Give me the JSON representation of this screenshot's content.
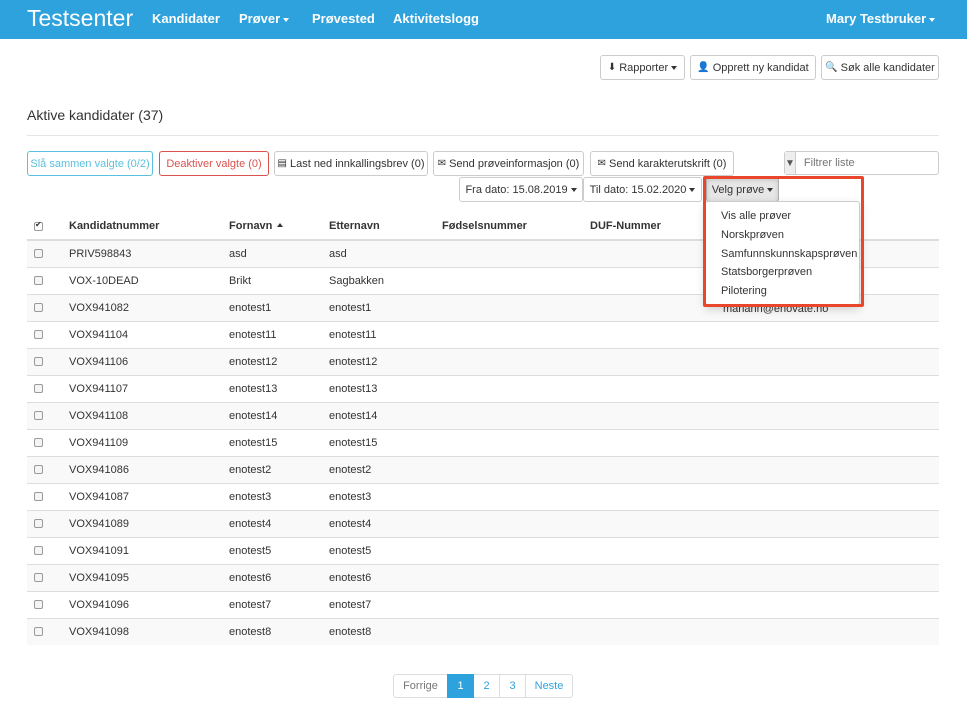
{
  "nav": {
    "brand": "Testsenter",
    "items": [
      "Kandidater",
      "Prøver",
      "Prøvested",
      "Aktivitetslogg"
    ],
    "user": "Mary Testbruker"
  },
  "toolbar": {
    "reports": "Rapporter",
    "new_candidate": "Opprett ny kandidat",
    "search_all": "Søk alle kandidater"
  },
  "heading": "Aktive kandidater (37)",
  "actions": {
    "merge": "Slå sammen valgte (0/2)",
    "deactivate": "Deaktiver valgte (0)",
    "download": "Last ned innkallingsbrev (0)",
    "send_info": "Send prøveinformasjon (0)",
    "send_grade": "Send karakterutskrift (0)"
  },
  "filter": {
    "placeholder": "Filtrer liste"
  },
  "dates": {
    "from": "Fra dato: 15.08.2019",
    "to": "Til dato: 15.02.2020"
  },
  "test_select": {
    "label": "Velg prøve",
    "options": [
      "Vis alle prøver",
      "Norskprøven",
      "Samfunnskunnskapsprøven",
      "Statsborgerprøven",
      "Pilotering"
    ]
  },
  "table": {
    "headers": [
      "Kandidatnummer",
      "Fornavn",
      "Etternavn",
      "Fødselsnummer",
      "DUF-Nummer"
    ],
    "partial_email": "mariann@enovate.no",
    "rows": [
      [
        "PRIV598843",
        "asd",
        "asd"
      ],
      [
        "VOX-10DEAD",
        "Brikt",
        "Sagbakken"
      ],
      [
        "VOX941082",
        "enotest1",
        "enotest1"
      ],
      [
        "VOX941104",
        "enotest11",
        "enotest11"
      ],
      [
        "VOX941106",
        "enotest12",
        "enotest12"
      ],
      [
        "VOX941107",
        "enotest13",
        "enotest13"
      ],
      [
        "VOX941108",
        "enotest14",
        "enotest14"
      ],
      [
        "VOX941109",
        "enotest15",
        "enotest15"
      ],
      [
        "VOX941086",
        "enotest2",
        "enotest2"
      ],
      [
        "VOX941087",
        "enotest3",
        "enotest3"
      ],
      [
        "VOX941089",
        "enotest4",
        "enotest4"
      ],
      [
        "VOX941091",
        "enotest5",
        "enotest5"
      ],
      [
        "VOX941095",
        "enotest6",
        "enotest6"
      ],
      [
        "VOX941096",
        "enotest7",
        "enotest7"
      ],
      [
        "VOX941098",
        "enotest8",
        "enotest8"
      ]
    ]
  },
  "pagination": {
    "prev": "Forrige",
    "pages": [
      "1",
      "2",
      "3"
    ],
    "next": "Neste",
    "current": "1"
  },
  "colors": {
    "primary": "#2ea2dc",
    "danger": "#d9534f",
    "info": "#5bc0de",
    "highlight": "#e8472b"
  }
}
